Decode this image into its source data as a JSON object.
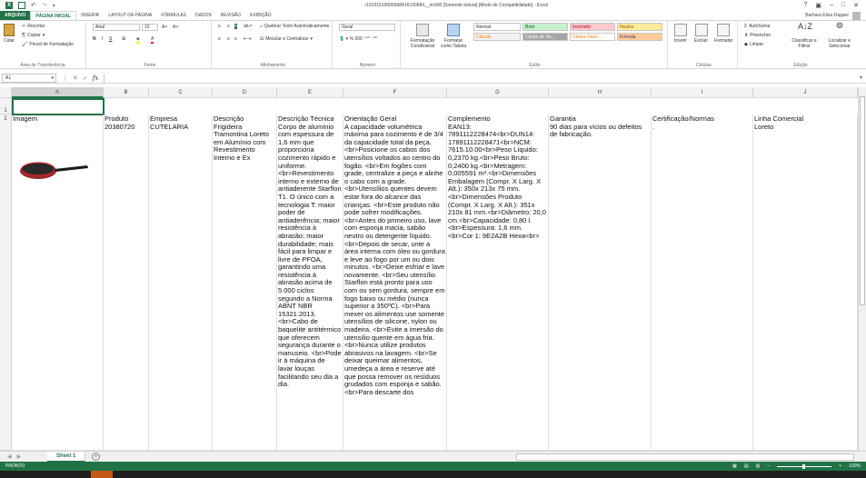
{
  "window": {
    "title": "r19101510095668416190684__im300 [Somente leitura] [Modo de Compatibilidade] - Excel",
    "user": "Barbara Elisa Dapper",
    "controls": [
      "?",
      "▣",
      "–",
      "□",
      "✕"
    ]
  },
  "tabs": [
    {
      "label": "ARQUIVO",
      "kind": "file"
    },
    {
      "label": "PÁGINA INICIAL",
      "kind": "active"
    },
    {
      "label": "INSERIR",
      "kind": ""
    },
    {
      "label": "LAYOUT DA PÁGINA",
      "kind": ""
    },
    {
      "label": "FÓRMULAS",
      "kind": ""
    },
    {
      "label": "DADOS",
      "kind": ""
    },
    {
      "label": "REVISÃO",
      "kind": ""
    },
    {
      "label": "EXIBIÇÃO",
      "kind": ""
    }
  ],
  "ribbon": {
    "clipboard": {
      "paste": "Colar",
      "cut": "Recortar",
      "copy": "Copiar",
      "format_painter": "Pincel de Formatação",
      "label": "Área de Transferência"
    },
    "font": {
      "name": "Arial",
      "size": "10",
      "label": "Fonte"
    },
    "alignment": {
      "wrap": "Quebrar Texto Automaticamente",
      "merge": "Mesclar e Centralizar",
      "label": "Alinhamento"
    },
    "number": {
      "format": "Geral",
      "label": "Número"
    },
    "styles": {
      "conditional": "Formatação Condicional",
      "as_table": "Formatar como Tabela",
      "cells": [
        {
          "text": "Normal",
          "bg": "#ffffff",
          "color": "#000000"
        },
        {
          "text": "Bom",
          "bg": "#c6efce",
          "color": "#006100"
        },
        {
          "text": "Incorreto",
          "bg": "#ffc7ce",
          "color": "#9c0006"
        },
        {
          "text": "Neutra",
          "bg": "#ffeb9c",
          "color": "#9c5700"
        },
        {
          "text": "Cálculo",
          "bg": "#f2f2f2",
          "color": "#fa7d00"
        },
        {
          "text": "Célula de Ve...",
          "bg": "#a5a5a5",
          "color": "#ffffff"
        },
        {
          "text": "Célula Vinco...",
          "bg": "#ffffff",
          "color": "#fa7d00"
        },
        {
          "text": "Entrada",
          "bg": "#ffcc99",
          "color": "#3f3f76"
        }
      ],
      "label": "Estilo"
    },
    "cells": {
      "insert": "Inserir",
      "delete": "Excluir",
      "format": "Formatar",
      "label": "Células"
    },
    "editing": {
      "autosum": "AutoSoma",
      "fill": "Preencher",
      "clear": "Limpar",
      "sort": "Classificar e Filtrar",
      "find": "Localizar e Selecionar",
      "label": "Edição"
    }
  },
  "formula_bar": {
    "name_box": "A1",
    "fx": "fx",
    "value": ""
  },
  "sheet": {
    "columns": [
      "A",
      "B",
      "C",
      "D",
      "E",
      "F",
      "G",
      "H",
      "I",
      "J"
    ],
    "rows": [
      "1",
      "2"
    ],
    "headers": [
      "Imagem",
      "Produto",
      "Empresa",
      "Descrição",
      "Descrição Técnica",
      "Orientação Geral",
      "Complemento",
      "Garantia",
      "Certificação/Normas",
      "Linha Comercial"
    ],
    "values": {
      "produto": "20380720",
      "empresa": "CUTELARIA",
      "descricao": "Frigideira Tramontina Loreto em Alumínio com Revestimento Interno e Ex",
      "descricao_tecnica": "Corpo de alumínio com espessura de 1,6 mm que proporciona cozimento rápido e uniforme. <br>Revestimento interno e externo de antiaderente Starflon T1. O único com a tecnologia T: maior poder de antiaderência; maior resistência à abrasão; maior durabilidade; mais fácil para limpar e livre de PFOA, garantindo uma resistência à abrasão acima de 5.000 ciclos segundo a Norma ABNT NBR 15321:2013. <br>Cabo de baquelite antitérmico que oferecem segurança durante o manuseio. <br>Pode ir à máquina de lavar louças facilitando seu dia a dia.",
      "orientacao": "A capacidade volumétrica máxima para cozimento é de 3/4 da capacidade total da peça. <br>Posicione os cabos dos utensílios voltados ao centro do fogão. <br>Em fogões com grade, centralize a peça e alinhe o cabo com a grade. <br>Utensílios quentes devem estar fora do alcance das crianças. <br>Este produto não pode sofrer modificações. <br>Antes do primeiro uso, lave com esponja macia, sabão neutro ou detergente líquido. <br>Depois de secar, unte a área interna com óleo ou gordura e leve ao fogo por um ou dois minutos. <br>Deixe esfriar e lave novamente. <br>Seu utensílio Starflon está pronto para uso com ou sem gordura, sempre em fogo baixo ou médio (nunca superior a 350ºC). <br>Para mexer os alimentos use somente utensílios de silicone, nylon ou madeira. <br>Evite a imersão do utensílio quente em água fria. <br>Nunca utilize produtos abrasivos na lavagem. <br>Se deixar queimar alimentos, umedeça a área e reserve até que possa remover os resíduos grudados com esponja e sabão. <br>Para descarte dos",
      "complemento": "EAN13: 7891112228474<br>DUN14: 17891112228471<br>NCM: 7615.10.00<br>Peso Líquido: 0,2370 kg.<br>Peso Bruto: 0,2400 kg.<br>Metragem: 0,005591 m³.<br>Dimensões Embalagem (Compr. X Larg. X Alt.): 350x 213x 75 mm.<br>Dimensões Produto (Compr. X Larg. X Alt.): 351x 210x 81 mm.<br>Diâmetro: 20,0 cm.<br>Capacidade: 0,80 l.<br>Espessura: 1,6 mm.<br>Cor 1: 9E2A2B Hexa<br>",
      "garantia": "90 dias para vícios ou defeitos de fabricação.",
      "certificacao": ".",
      "linha": "Loreto"
    }
  },
  "sheet_tabs": {
    "active": "Sheet 1",
    "add": "+"
  },
  "status": {
    "text": "PRONTO",
    "zoom": "100%",
    "zoom_level": 0.5
  },
  "colors": {
    "excel_green": "#217346",
    "pan_red": "#c8262a"
  }
}
